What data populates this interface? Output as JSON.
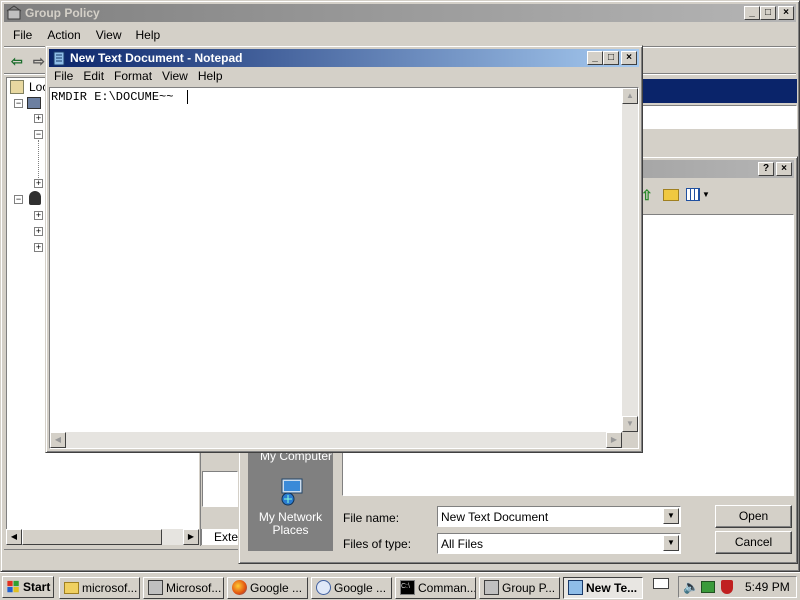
{
  "group_policy": {
    "title": "Group Policy",
    "menu": [
      "File",
      "Action",
      "View",
      "Help"
    ],
    "tree_root_label": "Loc",
    "tab_label": "Exter"
  },
  "open_dialog": {
    "places": {
      "my_computer": "My Computer",
      "my_network_places": "My Network Places"
    },
    "file_name_label": "File name:",
    "file_name_value": "New Text Document",
    "files_of_type_label": "Files of type:",
    "files_of_type_value": "All Files",
    "open_button": "Open",
    "cancel_button": "Cancel"
  },
  "notepad": {
    "title": "New Text Document - Notepad",
    "menu": [
      "File",
      "Edit",
      "Format",
      "View",
      "Help"
    ],
    "content": "RMDIR E:\\DOCUME~~"
  },
  "taskbar": {
    "start_label": "Start",
    "tasks": [
      {
        "label": "microsof...",
        "icon": "folder-icon"
      },
      {
        "label": "Microsof...",
        "icon": "app-icon"
      },
      {
        "label": "Google ...",
        "icon": "firefox-icon"
      },
      {
        "label": "Google ...",
        "icon": "search-icon"
      },
      {
        "label": "Comman...",
        "icon": "console-icon"
      },
      {
        "label": "Group P...",
        "icon": "policy-icon"
      },
      {
        "label": "New Te...",
        "icon": "notepad-icon"
      }
    ],
    "clock": "5:49 PM"
  },
  "colors": {
    "desktop": "#3a6ea5",
    "active_title": "#0a246a",
    "face": "#d4d0c8"
  }
}
